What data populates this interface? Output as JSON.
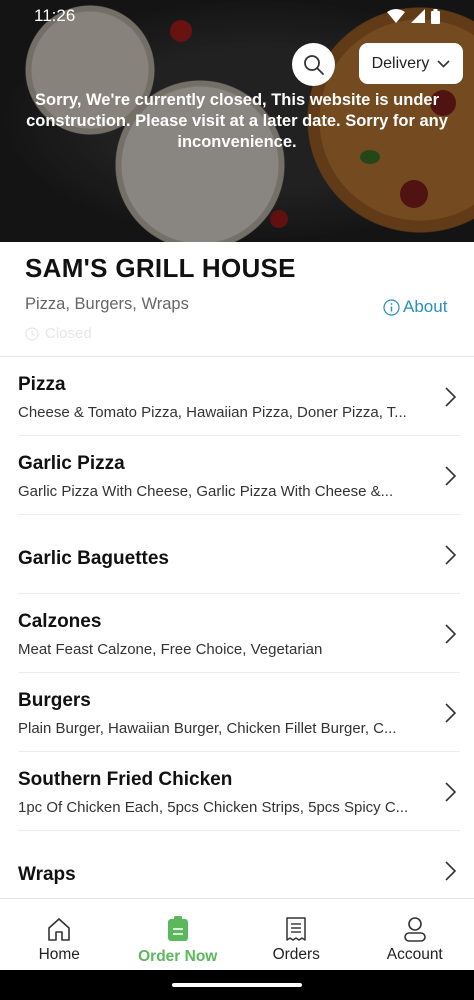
{
  "status_bar": {
    "time": "11:26"
  },
  "header": {
    "delivery_label": "Delivery",
    "closed_message": "Sorry, We're currently closed, This website is under construction. Please visit at a later date. Sorry for any inconvenience."
  },
  "restaurant": {
    "name": "SAM'S GRILL HOUSE",
    "cuisine": "Pizza, Burgers, Wraps",
    "about_label": "About",
    "status_label": "Closed"
  },
  "menu": {
    "categories": [
      {
        "title": "Pizza",
        "description": "Cheese & Tomato Pizza, Hawaiian Pizza, Doner Pizza, T..."
      },
      {
        "title": "Garlic Pizza",
        "description": "Garlic Pizza With Cheese, Garlic Pizza With Cheese &..."
      },
      {
        "title": "Garlic Baguettes",
        "description": ""
      },
      {
        "title": "Calzones",
        "description": "Meat Feast Calzone, Free Choice, Vegetarian"
      },
      {
        "title": "Burgers",
        "description": "Plain Burger, Hawaiian Burger, Chicken Fillet Burger, C..."
      },
      {
        "title": "Southern Fried Chicken",
        "description": "1pc Of Chicken Each, 5pcs Chicken Strips, 5pcs Spicy C..."
      },
      {
        "title": "Wraps",
        "description": ""
      }
    ]
  },
  "bottom_nav": {
    "home": "Home",
    "order_now": "Order Now",
    "orders": "Orders",
    "account": "Account"
  },
  "colors": {
    "accent_green": "#5cb85c",
    "link_blue": "#2a8fbd"
  }
}
